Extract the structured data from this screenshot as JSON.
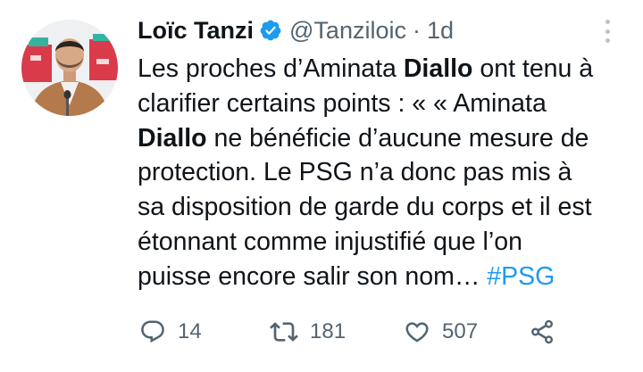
{
  "author": {
    "name": "Loïc Tanzi",
    "handle": "@Tanziloic",
    "separator": "·",
    "time": "1d"
  },
  "tweet": {
    "lines": [
      [
        {
          "t": "Les proches d’Aminata "
        },
        {
          "t": "Diallo",
          "b": true
        },
        {
          "t": " ont tenu à"
        }
      ],
      [
        {
          "t": "clarifier certains points : «  « Aminata"
        }
      ],
      [
        {
          "t": "Diallo",
          "b": true
        },
        {
          "t": " ne bénéficie d’aucune mesure de"
        }
      ],
      [
        {
          "t": "protection. Le PSG n’a donc pas mis à"
        }
      ],
      [
        {
          "t": "sa disposition de garde du corps et il est"
        }
      ],
      [
        {
          "t": "étonnant comme injustifié que l’on"
        }
      ],
      [
        {
          "t": "puisse encore salir son nom… "
        },
        {
          "t": "#PSG",
          "h": true
        }
      ]
    ]
  },
  "stats": {
    "replies": "14",
    "retweets": "181",
    "likes": "507"
  },
  "icons": {
    "verified": "verified-badge-icon",
    "more": "more-options-icon",
    "reply": "reply-icon",
    "retweet": "retweet-icon",
    "like": "heart-icon",
    "share": "share-icon"
  },
  "colors": {
    "accent": "#1d9bf0",
    "text": "#0f1419",
    "muted": "#536471"
  }
}
